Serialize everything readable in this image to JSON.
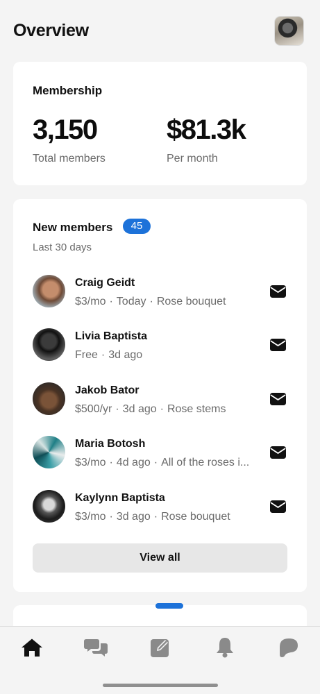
{
  "header": {
    "title": "Overview",
    "avatar": "profile-photo"
  },
  "membership": {
    "title": "Membership",
    "total_value": "3,150",
    "total_label": "Total members",
    "monthly_value": "$81.3k",
    "monthly_label": "Per month"
  },
  "new_members": {
    "title": "New members",
    "count": "45",
    "subtitle": "Last 30 days",
    "members": [
      {
        "name": "Craig Geidt",
        "price": "$3/mo",
        "when": "Today",
        "tier": "Rose bouquet"
      },
      {
        "name": "Livia Baptista",
        "price": "Free",
        "when": "3d ago",
        "tier": ""
      },
      {
        "name": "Jakob Bator",
        "price": "$500/yr",
        "when": "3d ago",
        "tier": "Rose stems"
      },
      {
        "name": "Maria Botosh",
        "price": "$3/mo",
        "when": "4d ago",
        "tier": "All of the roses i..."
      },
      {
        "name": "Kaylynn Baptista",
        "price": "$3/mo",
        "when": "3d ago",
        "tier": "Rose bouquet"
      }
    ],
    "separator": "·",
    "view_all_label": "View all"
  },
  "nav": {
    "items": [
      {
        "icon": "home-icon",
        "active": true
      },
      {
        "icon": "chat-icon",
        "active": false
      },
      {
        "icon": "edit-icon",
        "active": false
      },
      {
        "icon": "bell-icon",
        "active": false
      },
      {
        "icon": "patreon-icon",
        "active": false
      }
    ]
  },
  "colors": {
    "accent": "#1d72d9",
    "background": "#f4f4f4",
    "card": "#ffffff",
    "muted_text": "#6b6b6b",
    "inactive_icon": "#8a8a8a"
  }
}
